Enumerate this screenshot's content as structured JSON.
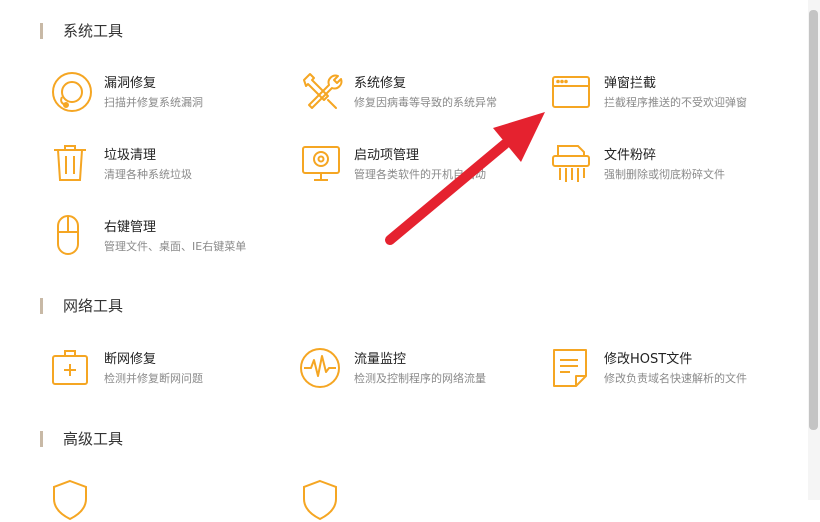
{
  "sections": [
    {
      "title": "系统工具",
      "tools": [
        {
          "name": "漏洞修复",
          "desc": "扫描并修复系统漏洞",
          "icon": "lifebuoy-icon"
        },
        {
          "name": "系统修复",
          "desc": "修复因病毒等导致的系统异常",
          "icon": "wrench-screwdriver-icon"
        },
        {
          "name": "弹窗拦截",
          "desc": "拦截程序推送的不受欢迎弹窗",
          "icon": "window-icon"
        },
        {
          "name": "垃圾清理",
          "desc": "清理各种系统垃圾",
          "icon": "trash-icon"
        },
        {
          "name": "启动项管理",
          "desc": "管理各类软件的开机自启动",
          "icon": "monitor-icon"
        },
        {
          "name": "文件粉碎",
          "desc": "强制删除或彻底粉碎文件",
          "icon": "shredder-icon"
        },
        {
          "name": "右键管理",
          "desc": "管理文件、桌面、IE右键菜单",
          "icon": "mouse-icon"
        }
      ]
    },
    {
      "title": "网络工具",
      "tools": [
        {
          "name": "断网修复",
          "desc": "检测并修复断网问题",
          "icon": "first-aid-kit-icon"
        },
        {
          "name": "流量监控",
          "desc": "检测及控制程序的网络流量",
          "icon": "pulse-icon"
        },
        {
          "name": "修改HOST文件",
          "desc": "修改负责域名快速解析的文件",
          "icon": "document-icon"
        }
      ]
    },
    {
      "title": "高级工具",
      "tools": [
        {
          "name": "",
          "desc": "",
          "icon": "shield-icon"
        },
        {
          "name": "",
          "desc": "",
          "icon": "shield-icon"
        }
      ]
    }
  ],
  "colors": {
    "accent": "#f5a623",
    "arrow": "#e5222f"
  }
}
